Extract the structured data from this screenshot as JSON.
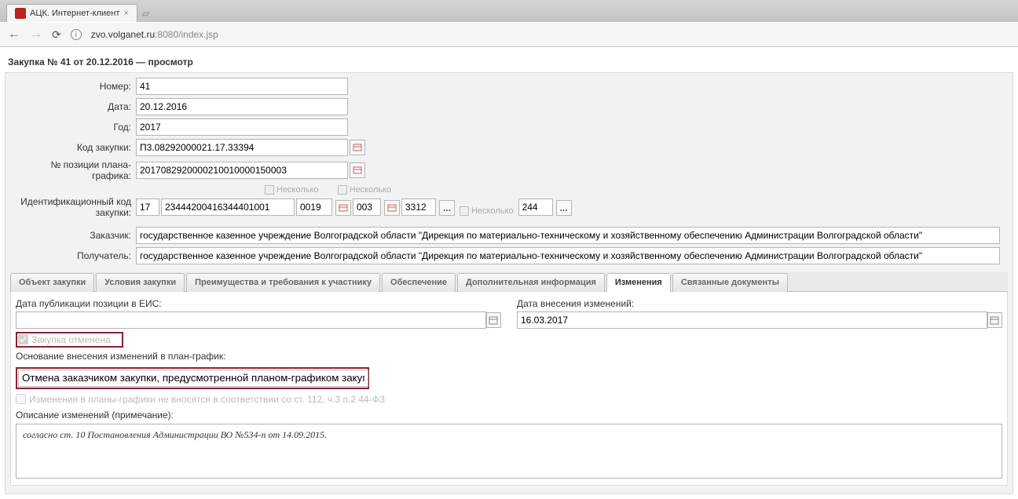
{
  "browser": {
    "tab_title": "АЦК. Интернет-клиент",
    "url_host": "zvo.volganet.ru",
    "url_port_path": ":8080/index.jsp"
  },
  "page": {
    "title": "Закупка № 41 от 20.12.2016 — просмотр"
  },
  "form": {
    "number_label": "Номер:",
    "number_value": "41",
    "date_label": "Дата:",
    "date_value": "20.12.2016",
    "year_label": "Год:",
    "year_value": "2017",
    "purchase_code_label": "Код закупки:",
    "purchase_code_value": "П3.08292000021.17.33394",
    "plan_pos_label_1": "№ позиции плана-",
    "plan_pos_label_2": "графика:",
    "plan_pos_value": "2017082920000210010000150003",
    "several_label": "Несколько",
    "idcode_label_1": "Идентификационный код",
    "idcode_label_2": "закупки:",
    "idcode_p1": "17",
    "idcode_p2": "23444200416344401001",
    "idcode_p3": "0019",
    "idcode_p4": "003",
    "idcode_p5": "3312",
    "idcode_p6": "244",
    "customer_label": "Заказчик:",
    "customer_value": "государственное казенное учреждение Волгоградской области \"Дирекция по материально-техническому и хозяйственному обеспечению Администрации Волгоградской области\"",
    "recipient_label": "Получатель:",
    "recipient_value": "государственное казенное учреждение Волгоградской области \"Дирекция по материально-техническому и хозяйственному обеспечению Администрации Волгоградской области\""
  },
  "tabs": {
    "t1": "Объект закупки",
    "t2": "Условия закупки",
    "t3": "Преимущества и требования к участнику",
    "t4": "Обеспечение",
    "t5": "Дополнительная информация",
    "t6": "Изменения",
    "t7": "Связанные документы"
  },
  "changes": {
    "pub_date_label": "Дата публикации позиции в ЕИС:",
    "pub_date_value": "",
    "change_date_label": "Дата внесения изменений:",
    "change_date_value": "16.03.2017",
    "cancelled_label": "Закупка отменена",
    "basis_label": "Основание внесения изменений в план-график:",
    "basis_value": "Отмена заказчиком закупки, предусмотренной планом-графиком закупок",
    "no_changes_label": "Изменения в планы-графики не вносятся в соответствии со ст. 112, ч.3 п.2 44-ФЗ",
    "desc_label": "Описание изменений (примечание):",
    "desc_value": "согласно ст. 10 Постановления Администрации ВО №534-п от 14.09.2015."
  }
}
